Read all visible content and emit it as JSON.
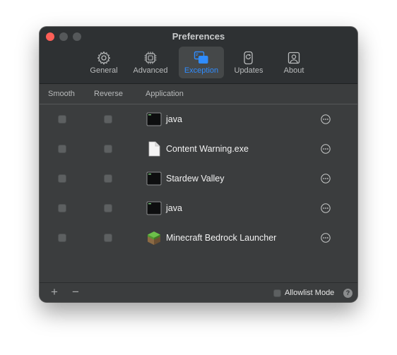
{
  "window": {
    "title": "Preferences"
  },
  "tabs": [
    {
      "label": "General",
      "icon": "gear-icon"
    },
    {
      "label": "Advanced",
      "icon": "chip-icon"
    },
    {
      "label": "Exception",
      "icon": "windows-icon",
      "active": true
    },
    {
      "label": "Updates",
      "icon": "update-icon"
    },
    {
      "label": "About",
      "icon": "person-icon"
    }
  ],
  "columns": {
    "smooth": "Smooth",
    "reverse": "Reverse",
    "application": "Application"
  },
  "apps": [
    {
      "name": "java",
      "icon": "terminal-icon",
      "smooth": false,
      "reverse": false
    },
    {
      "name": "Content Warning.exe",
      "icon": "document-icon",
      "smooth": false,
      "reverse": false
    },
    {
      "name": "Stardew Valley",
      "icon": "terminal-icon",
      "smooth": false,
      "reverse": false
    },
    {
      "name": "java",
      "icon": "terminal-icon",
      "smooth": false,
      "reverse": false
    },
    {
      "name": "Minecraft Bedrock Launcher",
      "icon": "minecraft-grass-block-icon",
      "smooth": false,
      "reverse": false
    }
  ],
  "footer": {
    "add_label": "+",
    "remove_label": "−",
    "allowlist_label": "Allowlist Mode",
    "allowlist_checked": false,
    "help_label": "?"
  },
  "colors": {
    "accent": "#2f8cff",
    "close": "#fe5f57"
  }
}
